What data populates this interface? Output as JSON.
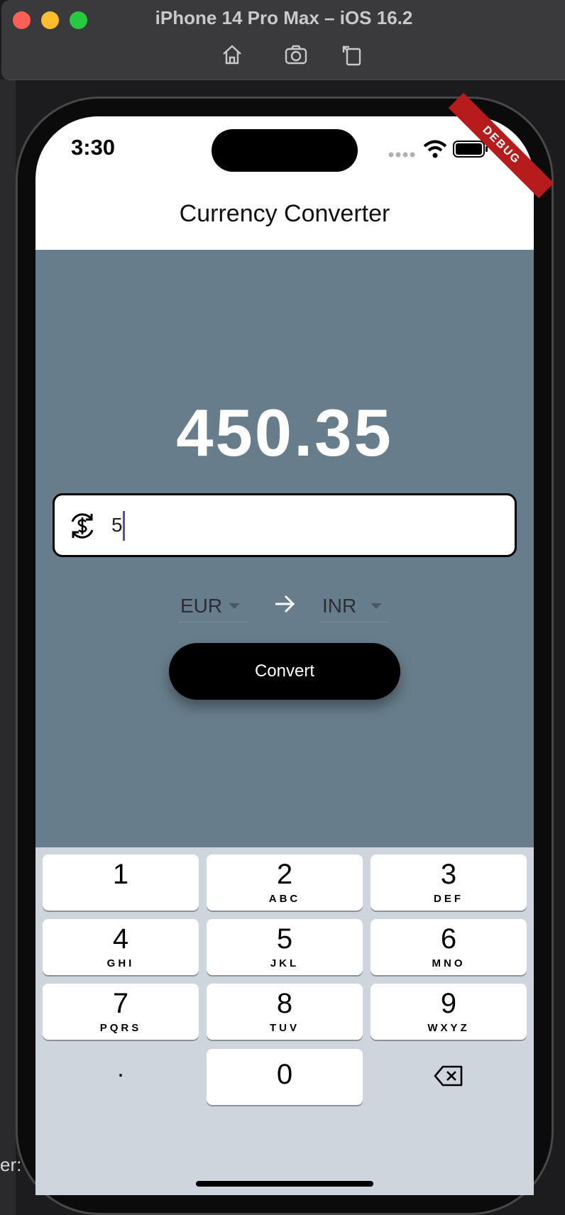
{
  "simulator": {
    "title": "iPhone 14 Pro Max – iOS 16.2",
    "background_text": "er:"
  },
  "status_bar": {
    "time": "3:30",
    "debug_label": "DEBUG"
  },
  "app": {
    "title": "Currency Converter",
    "result": "450.35",
    "amount_value": "5",
    "from_currency": "EUR",
    "to_currency": "INR",
    "convert_label": "Convert"
  },
  "keyboard": {
    "keys": [
      {
        "num": "1",
        "sub": ""
      },
      {
        "num": "2",
        "sub": "ABC"
      },
      {
        "num": "3",
        "sub": "DEF"
      },
      {
        "num": "4",
        "sub": "GHI"
      },
      {
        "num": "5",
        "sub": "JKL"
      },
      {
        "num": "6",
        "sub": "MNO"
      },
      {
        "num": "7",
        "sub": "PQRS"
      },
      {
        "num": "8",
        "sub": "TUV"
      },
      {
        "num": "9",
        "sub": "WXYZ"
      },
      {
        "num": "0",
        "sub": ""
      }
    ],
    "decimal": "."
  },
  "colors": {
    "body_background": "#687d8b",
    "keyboard_background": "#cfd5dd",
    "button": "#000000",
    "debug_banner": "#b71c1c"
  }
}
